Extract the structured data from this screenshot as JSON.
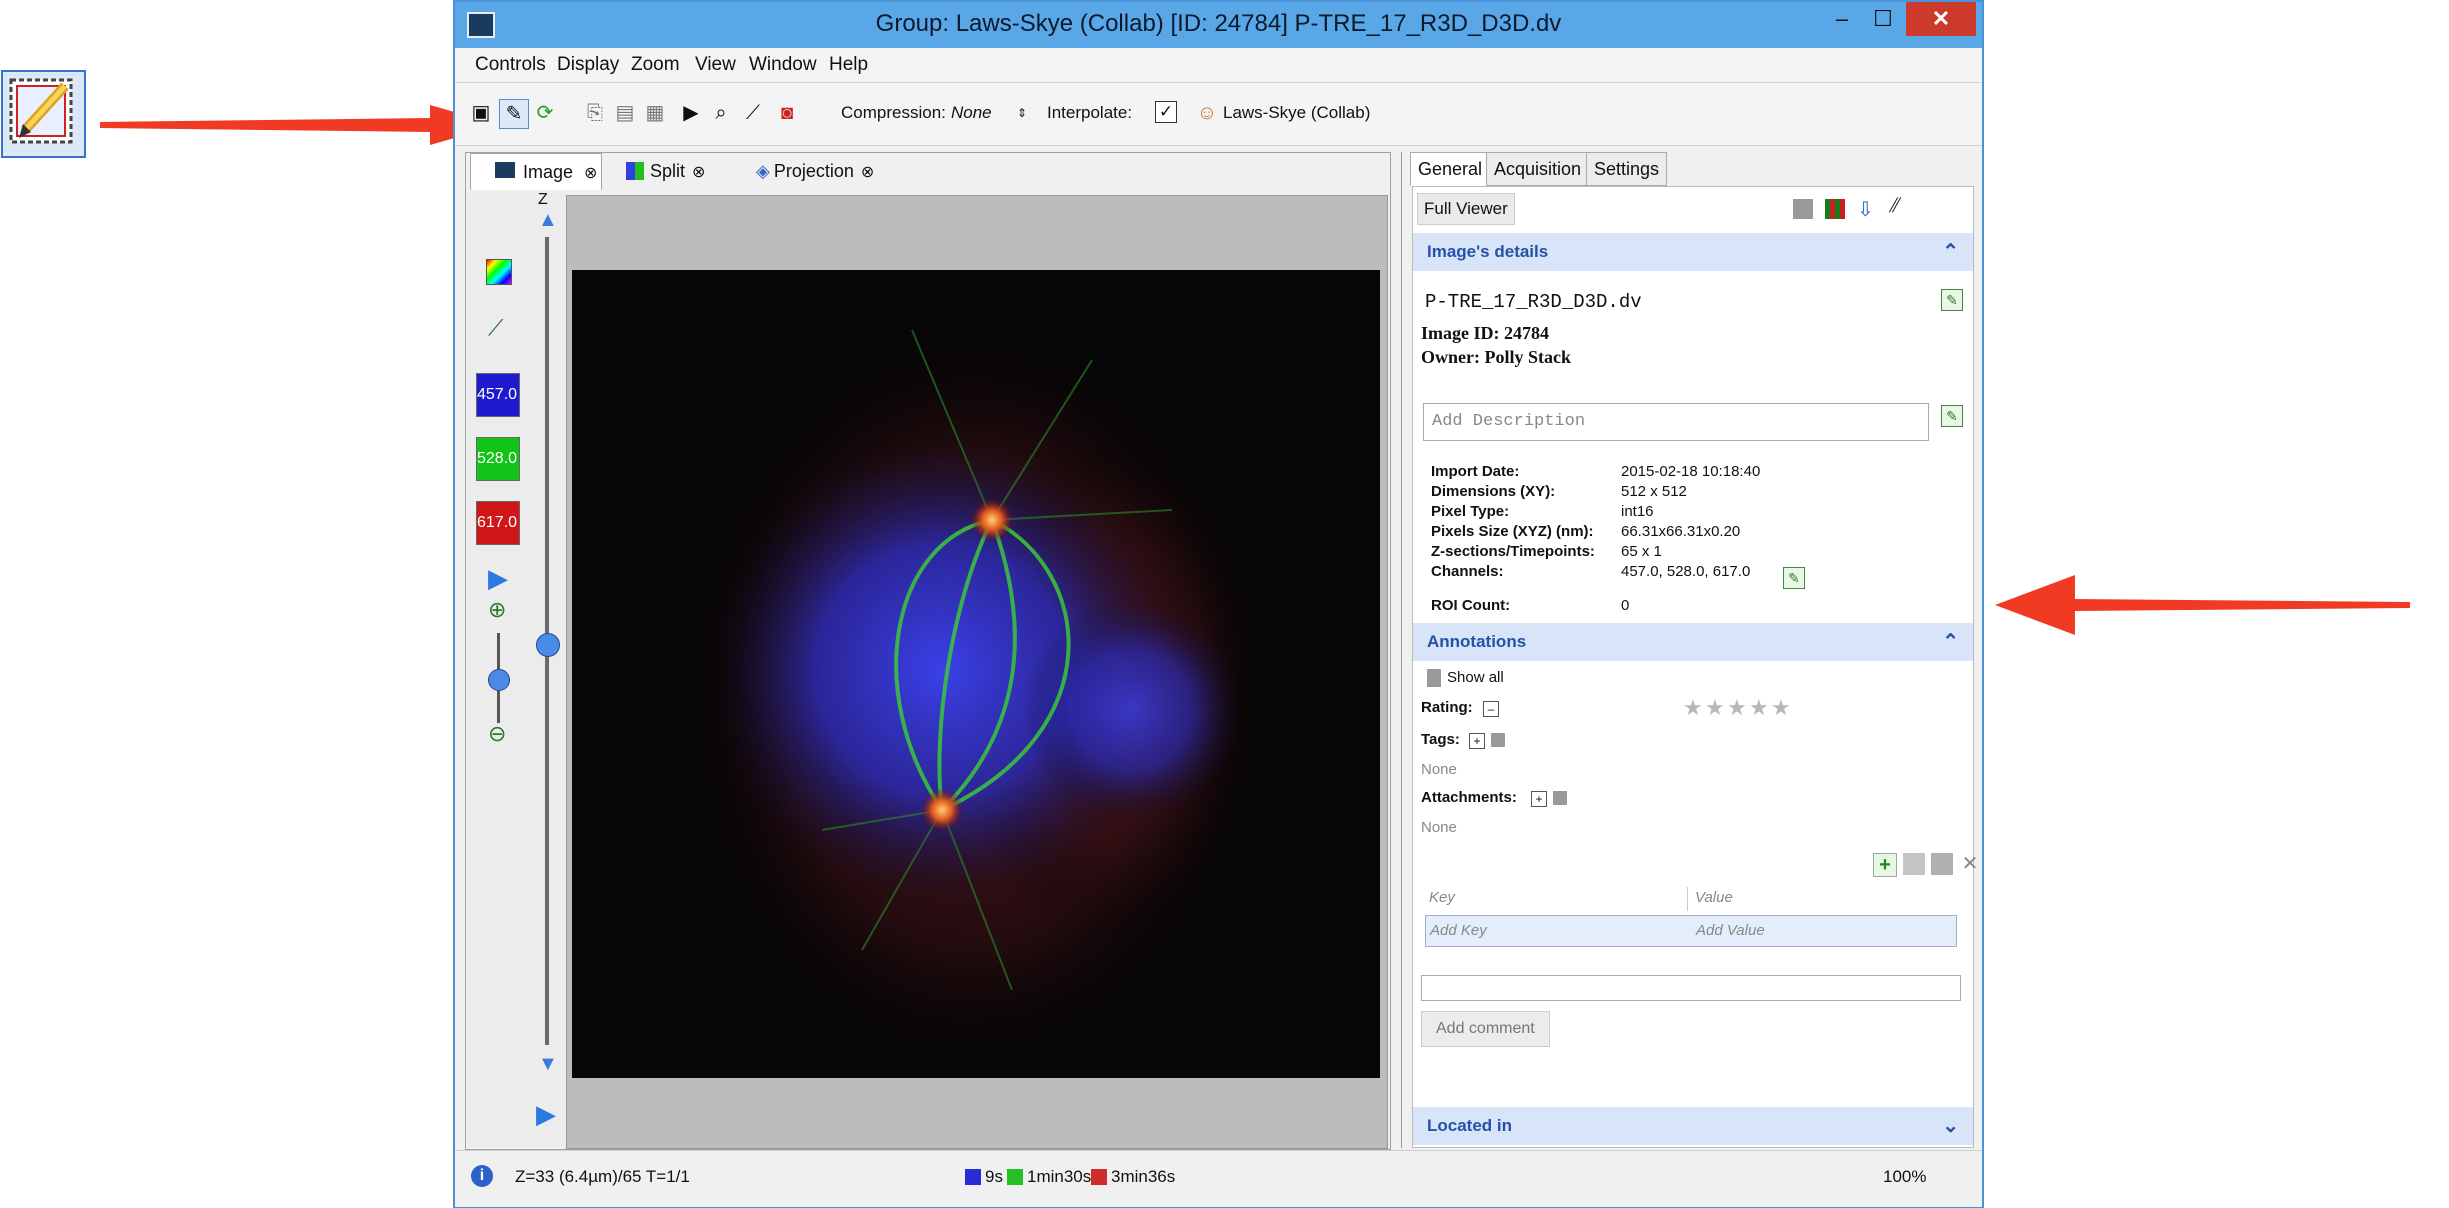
{
  "window": {
    "title": "Group: Laws-Skye (Collab) [ID: 24784] P-TRE_17_R3D_D3D.dv",
    "controls": {
      "minimize": "–",
      "maximize": "☐",
      "close": "✕"
    }
  },
  "menu": [
    "Controls",
    "Display",
    "Zoom",
    "View",
    "Window",
    "Help"
  ],
  "toolbar": {
    "compression_label": "Compression:",
    "compression_value": "None",
    "interpolate_label": "Interpolate:",
    "interpolate_checked": true,
    "group_label": "Laws-Skye (Collab)"
  },
  "viewer_tabs": [
    {
      "label": "Image",
      "icon": "image-icon",
      "selected": true
    },
    {
      "label": "Split",
      "icon": "split-icon",
      "selected": false
    },
    {
      "label": "Projection",
      "icon": "projection-icon",
      "selected": false
    }
  ],
  "channels": [
    {
      "label": "457.0",
      "color": "#1f1ad0"
    },
    {
      "label": "528.0",
      "color": "#12c417"
    },
    {
      "label": "617.0",
      "color": "#d01616"
    }
  ],
  "z_label": "Z",
  "right_tabs": [
    "General",
    "Acquisition",
    "Settings"
  ],
  "viewer_name": "Full Viewer",
  "image_details": {
    "header": "Image's details",
    "file_name": "P-TRE_17_R3D_D3D.dv",
    "image_id": "Image ID: 24784",
    "owner": "Owner: Polly Stack",
    "description_placeholder": "Add Description",
    "fields": [
      {
        "label": "Import Date:",
        "value": "2015-02-18 10:18:40"
      },
      {
        "label": "Dimensions (XY):",
        "value": "512 x 512"
      },
      {
        "label": "Pixel Type:",
        "value": "int16"
      },
      {
        "label": "Pixels Size (XYZ) (nm):",
        "value": "66.31x66.31x0.20"
      },
      {
        "label": "Z-sections/Timepoints:",
        "value": "65 x 1"
      },
      {
        "label": "Channels:",
        "value": "457.0, 528.0, 617.0"
      },
      {
        "label": "ROI Count:",
        "value": "0"
      }
    ]
  },
  "annotations": {
    "header": "Annotations",
    "show_all": "Show all",
    "rating_label": "Rating:",
    "rating": 0,
    "rating_max": 5,
    "tags_label": "Tags:",
    "tags_value": "None",
    "attachments_label": "Attachments:",
    "attachments_value": "None",
    "kv_headers": {
      "key": "Key",
      "value": "Value"
    },
    "kv_placeholders": {
      "key": "Add Key",
      "value": "Add Value"
    },
    "add_comment": "Add comment"
  },
  "located_in": "Located in",
  "status": {
    "position": "Z=33 (6.4µm)/65 T=1/1",
    "time_blue": "9s",
    "time_green": "1min30s",
    "time_red": "3min36s",
    "zoom": "100%"
  }
}
